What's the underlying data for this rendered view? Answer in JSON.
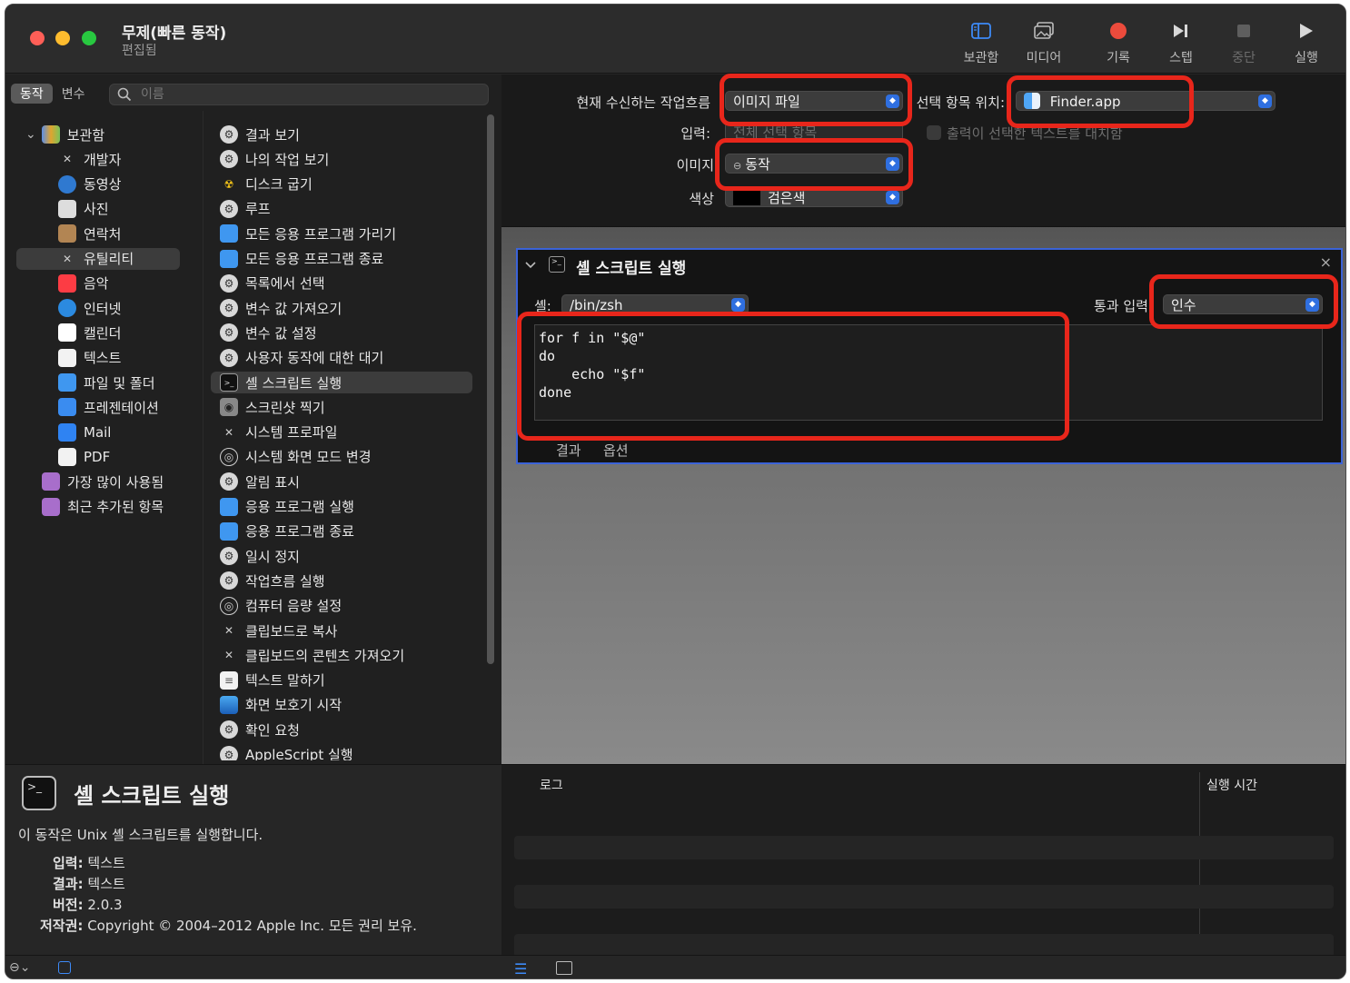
{
  "window": {
    "title": "무제(빠른 동작)",
    "subtitle": "편집됨"
  },
  "toolbar": {
    "library": "보관함",
    "media": "미디어",
    "record": "기록",
    "step": "스텝",
    "stop": "중단",
    "run": "실행"
  },
  "left": {
    "seg_actions": "동작",
    "seg_variables": "변수",
    "search_placeholder": "이름",
    "library": [
      {
        "label": "보관함",
        "icon": "library-icon"
      },
      {
        "label": "개발자",
        "icon": "developer-icon"
      },
      {
        "label": "동영상",
        "icon": "movies-icon"
      },
      {
        "label": "사진",
        "icon": "photos-icon"
      },
      {
        "label": "연락처",
        "icon": "contacts-icon"
      },
      {
        "label": "유틸리티",
        "icon": "utilities-icon"
      },
      {
        "label": "음악",
        "icon": "music-icon"
      },
      {
        "label": "인터넷",
        "icon": "internet-icon"
      },
      {
        "label": "캘린더",
        "icon": "calendar-icon"
      },
      {
        "label": "텍스트",
        "icon": "text-icon"
      },
      {
        "label": "파일 및 폴더",
        "icon": "files-folders-icon"
      },
      {
        "label": "프레젠테이션",
        "icon": "presentations-icon"
      },
      {
        "label": "Mail",
        "icon": "mail-icon"
      },
      {
        "label": "PDF",
        "icon": "pdf-icon"
      },
      {
        "label": "가장 많이 사용됨",
        "icon": "most-used-icon"
      },
      {
        "label": "최근 추가된 항목",
        "icon": "recently-added-icon"
      }
    ],
    "actions": [
      "결과 보기",
      "나의 작업 보기",
      "디스크 굽기",
      "루프",
      "모든 응용 프로그램 가리기",
      "모든 응용 프로그램 종료",
      "목록에서 선택",
      "변수 값 가져오기",
      "변수 값 설정",
      "사용자 동작에 대한 대기",
      "셸 스크립트 실행",
      "스크린샷 찍기",
      "시스템 프로파일",
      "시스템 화면 모드 변경",
      "알림 표시",
      "응용 프로그램 실행",
      "응용 프로그램 종료",
      "일시 정지",
      "작업흐름 실행",
      "컴퓨터 음량 설정",
      "클립보드로 복사",
      "클립보드의 콘텐츠 가져오기",
      "텍스트 말하기",
      "화면 보호기 시작",
      "확인 요청",
      "AppleScript 실행"
    ]
  },
  "info": {
    "title": "셸 스크립트 실행",
    "description": "이 동작은 Unix 셸 스크립트를 실행합니다.",
    "input_label": "입력:",
    "input_value": "텍스트",
    "result_label": "결과:",
    "result_value": "텍스트",
    "version_label": "버전:",
    "version_value": "2.0.3",
    "copyright_label": "저작권:",
    "copyright_value": "Copyright © 2004–2012 Apple Inc.  모든 권리 보유."
  },
  "workflow": {
    "receives_label": "현재 수신하는 작업흐름",
    "receives_value": "이미지 파일",
    "in_label": "선택 항목 위치:",
    "in_value": "Finder.app",
    "input_label": "입력:",
    "input_value": "전체 선택 항목",
    "output_replaces": "출력이 선택한 텍스트를 대치함",
    "image_label": "이미지",
    "image_value": "동작",
    "color_label": "색상",
    "color_value": "검은색"
  },
  "action": {
    "title": "셸 스크립트 실행",
    "shell_label": "셸:",
    "shell_value": "/bin/zsh",
    "pass_input_label": "통과 입력",
    "pass_input_value": "인수",
    "script": "for f in \"$@\"\ndo\n    echo \"$f\"\ndone",
    "tab_results": "결과",
    "tab_options": "옵션"
  },
  "log": {
    "col_log": "로그",
    "col_duration": "실행 시간"
  },
  "colors": {
    "highlight": "#e8261b",
    "accent": "#2f6fe0",
    "selection_border": "#3b63d8"
  }
}
